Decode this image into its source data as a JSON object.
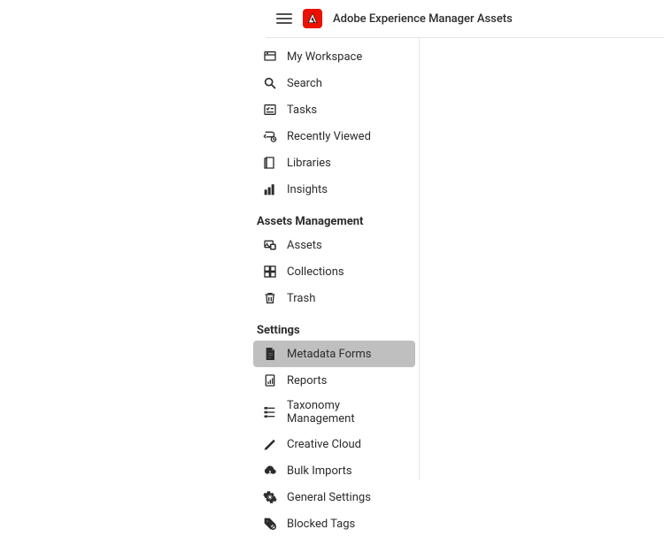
{
  "header": {
    "app_title": "Adobe Experience Manager Assets"
  },
  "sidebar": {
    "top_items": [
      {
        "label": "My Workspace",
        "icon": "workspace-icon"
      },
      {
        "label": "Search",
        "icon": "search-icon"
      },
      {
        "label": "Tasks",
        "icon": "tasks-icon"
      },
      {
        "label": "Recently Viewed",
        "icon": "recent-icon"
      },
      {
        "label": "Libraries",
        "icon": "libraries-icon"
      },
      {
        "label": "Insights",
        "icon": "insights-icon"
      }
    ],
    "sections": [
      {
        "header": "Assets Management",
        "items": [
          {
            "label": "Assets",
            "icon": "assets-icon"
          },
          {
            "label": "Collections",
            "icon": "collections-icon"
          },
          {
            "label": "Trash",
            "icon": "trash-icon"
          }
        ]
      },
      {
        "header": "Settings",
        "items": [
          {
            "label": "Metadata Forms",
            "icon": "metadata-icon",
            "selected": true
          },
          {
            "label": "Reports",
            "icon": "reports-icon"
          },
          {
            "label": "Taxonomy Management",
            "icon": "taxonomy-icon"
          },
          {
            "label": "Creative Cloud",
            "icon": "creative-cloud-icon"
          },
          {
            "label": "Bulk Imports",
            "icon": "bulk-imports-icon"
          },
          {
            "label": "General Settings",
            "icon": "general-settings-icon"
          },
          {
            "label": "Blocked Tags",
            "icon": "blocked-tags-icon"
          }
        ]
      }
    ]
  }
}
